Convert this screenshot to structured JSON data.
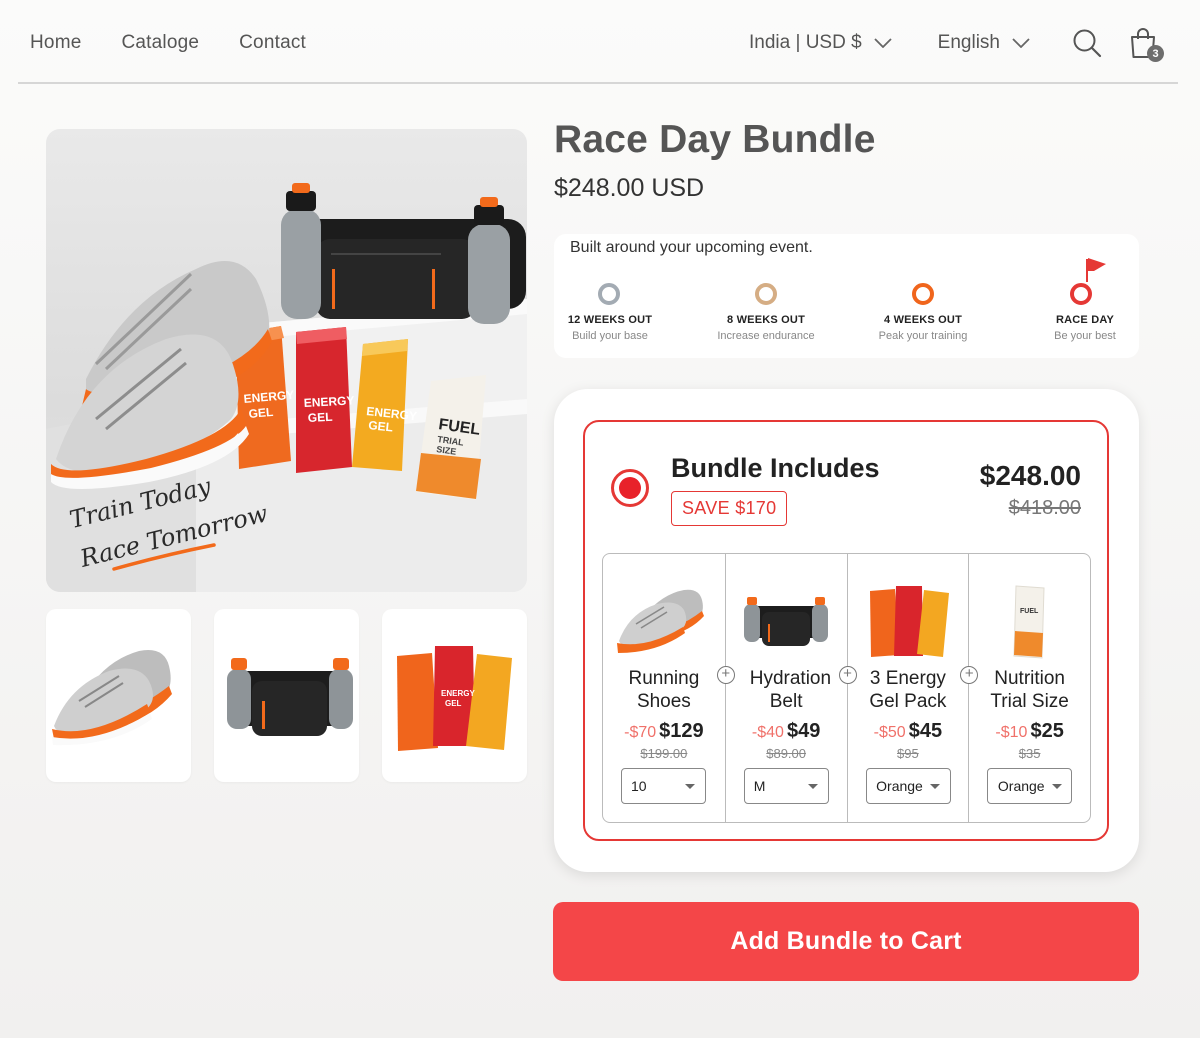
{
  "nav": {
    "items": [
      "Home",
      "Cataloge",
      "Contact"
    ]
  },
  "header": {
    "locale": "India | USD $",
    "language": "English",
    "cart_count": "3"
  },
  "gallery": {
    "slogan_line1": "Train Today",
    "slogan_line2": "Race Tomorrow",
    "main_gel_labels": [
      "ENERGY GEL",
      "ENERGY GEL",
      "ENERGY GEL"
    ],
    "fuel_label": "FUEL",
    "fuel_sub": "TRIAL SIZE"
  },
  "product": {
    "title": "Race Day Bundle",
    "price": "$248.00 USD"
  },
  "timeline": {
    "heading": "Built around your upcoming event.",
    "steps": [
      {
        "label": "12 WEEKS OUT",
        "sub": "Build your base"
      },
      {
        "label": "8 WEEKS OUT",
        "sub": "Increase endurance"
      },
      {
        "label": "4 WEEKS OUT",
        "sub": "Peak your training"
      },
      {
        "label": "RACE DAY",
        "sub": "Be your best"
      }
    ]
  },
  "bundle": {
    "title": "Bundle Includes",
    "save": "SAVE $170",
    "price": "$248.00",
    "original_price": "$418.00",
    "items": [
      {
        "name": "Running Shoes",
        "discount": "-$70",
        "price": "$129",
        "original": "$199.00",
        "option": "10"
      },
      {
        "name": "Hydration Belt",
        "discount": "-$40",
        "price": "$49",
        "original": "$89.00",
        "option": "M"
      },
      {
        "name": "3 Energy Gel Pack",
        "discount": "-$50",
        "price": "$45",
        "original": "$95",
        "option": "Orange"
      },
      {
        "name": "Nutrition Trial Size",
        "discount": "-$10",
        "price": "$25",
        "original": "$35",
        "option": "Orange"
      }
    ]
  },
  "cta": {
    "label": "Add Bundle to Cart"
  },
  "colors": {
    "accent": "#f44648",
    "accent_border": "#e53835",
    "shoe_orange": "#f26a1b"
  }
}
